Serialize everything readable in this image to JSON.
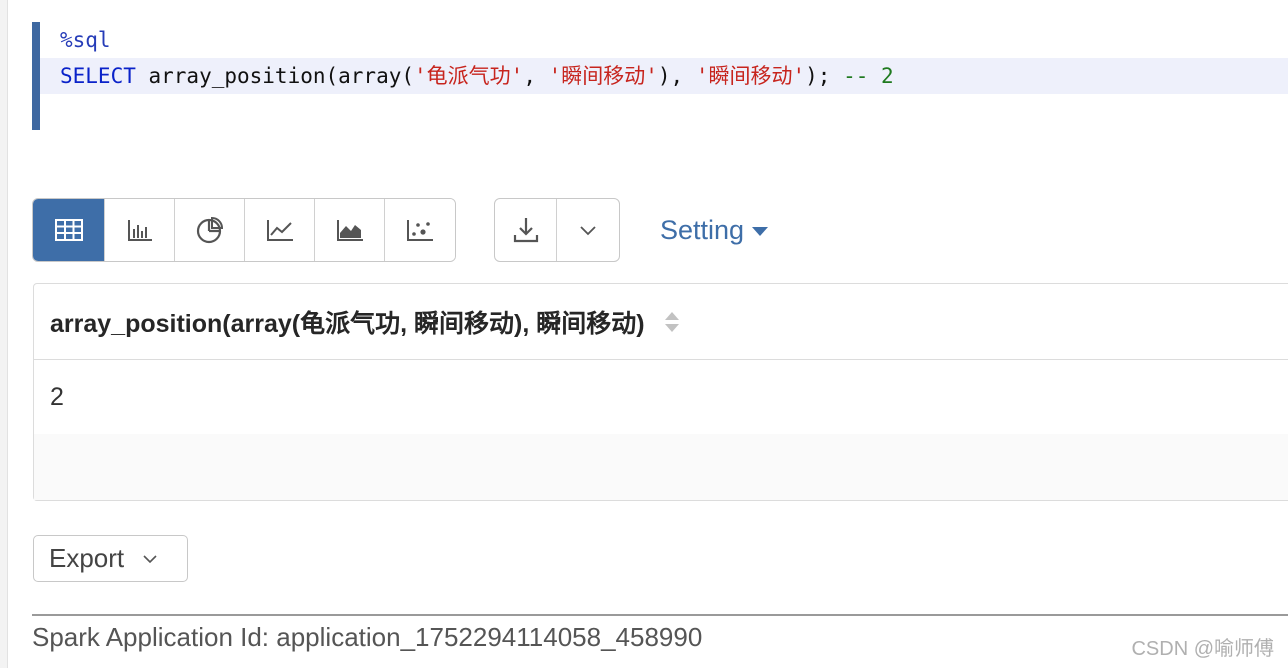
{
  "editor": {
    "line1": {
      "magic": "%sql"
    },
    "line2": {
      "keyword": "SELECT",
      "pre": " array_position(array(",
      "str1": "'龟派气功'",
      "sep1": ", ",
      "str2": "'瞬间移动'",
      "mid": "), ",
      "str3": "'瞬间移动'",
      "end": "); ",
      "comment": "-- 2"
    }
  },
  "toolbar": {
    "viz_buttons": [
      {
        "icon": "table-icon",
        "active": true
      },
      {
        "icon": "bar-chart-icon",
        "active": false
      },
      {
        "icon": "pie-chart-icon",
        "active": false
      },
      {
        "icon": "line-chart-icon",
        "active": false
      },
      {
        "icon": "area-chart-icon",
        "active": false
      },
      {
        "icon": "scatter-chart-icon",
        "active": false
      }
    ],
    "download_icon": "download-icon",
    "dropdown_icon": "chevron-down-icon",
    "setting_label": "Setting",
    "accent_color": "#3e6ea8"
  },
  "table": {
    "columns": [
      "array_position(array(龟派气功, 瞬间移动), 瞬间移动)"
    ],
    "rows": [
      [
        "2"
      ]
    ]
  },
  "export": {
    "label": "Export"
  },
  "footer": {
    "app_id": "Spark Application Id: application_1752294114058_458990",
    "watermark": "CSDN @喻师傅"
  }
}
